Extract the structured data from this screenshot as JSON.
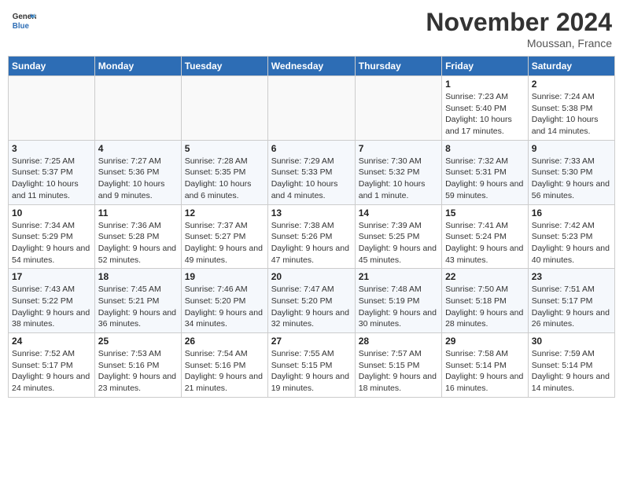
{
  "header": {
    "logo_general": "General",
    "logo_blue": "Blue",
    "month_title": "November 2024",
    "location": "Moussan, France"
  },
  "weekdays": [
    "Sunday",
    "Monday",
    "Tuesday",
    "Wednesday",
    "Thursday",
    "Friday",
    "Saturday"
  ],
  "weeks": [
    [
      {
        "day": "",
        "sunrise": "",
        "sunset": "",
        "daylight": ""
      },
      {
        "day": "",
        "sunrise": "",
        "sunset": "",
        "daylight": ""
      },
      {
        "day": "",
        "sunrise": "",
        "sunset": "",
        "daylight": ""
      },
      {
        "day": "",
        "sunrise": "",
        "sunset": "",
        "daylight": ""
      },
      {
        "day": "",
        "sunrise": "",
        "sunset": "",
        "daylight": ""
      },
      {
        "day": "1",
        "sunrise": "Sunrise: 7:23 AM",
        "sunset": "Sunset: 5:40 PM",
        "daylight": "Daylight: 10 hours and 17 minutes."
      },
      {
        "day": "2",
        "sunrise": "Sunrise: 7:24 AM",
        "sunset": "Sunset: 5:38 PM",
        "daylight": "Daylight: 10 hours and 14 minutes."
      }
    ],
    [
      {
        "day": "3",
        "sunrise": "Sunrise: 7:25 AM",
        "sunset": "Sunset: 5:37 PM",
        "daylight": "Daylight: 10 hours and 11 minutes."
      },
      {
        "day": "4",
        "sunrise": "Sunrise: 7:27 AM",
        "sunset": "Sunset: 5:36 PM",
        "daylight": "Daylight: 10 hours and 9 minutes."
      },
      {
        "day": "5",
        "sunrise": "Sunrise: 7:28 AM",
        "sunset": "Sunset: 5:35 PM",
        "daylight": "Daylight: 10 hours and 6 minutes."
      },
      {
        "day": "6",
        "sunrise": "Sunrise: 7:29 AM",
        "sunset": "Sunset: 5:33 PM",
        "daylight": "Daylight: 10 hours and 4 minutes."
      },
      {
        "day": "7",
        "sunrise": "Sunrise: 7:30 AM",
        "sunset": "Sunset: 5:32 PM",
        "daylight": "Daylight: 10 hours and 1 minute."
      },
      {
        "day": "8",
        "sunrise": "Sunrise: 7:32 AM",
        "sunset": "Sunset: 5:31 PM",
        "daylight": "Daylight: 9 hours and 59 minutes."
      },
      {
        "day": "9",
        "sunrise": "Sunrise: 7:33 AM",
        "sunset": "Sunset: 5:30 PM",
        "daylight": "Daylight: 9 hours and 56 minutes."
      }
    ],
    [
      {
        "day": "10",
        "sunrise": "Sunrise: 7:34 AM",
        "sunset": "Sunset: 5:29 PM",
        "daylight": "Daylight: 9 hours and 54 minutes."
      },
      {
        "day": "11",
        "sunrise": "Sunrise: 7:36 AM",
        "sunset": "Sunset: 5:28 PM",
        "daylight": "Daylight: 9 hours and 52 minutes."
      },
      {
        "day": "12",
        "sunrise": "Sunrise: 7:37 AM",
        "sunset": "Sunset: 5:27 PM",
        "daylight": "Daylight: 9 hours and 49 minutes."
      },
      {
        "day": "13",
        "sunrise": "Sunrise: 7:38 AM",
        "sunset": "Sunset: 5:26 PM",
        "daylight": "Daylight: 9 hours and 47 minutes."
      },
      {
        "day": "14",
        "sunrise": "Sunrise: 7:39 AM",
        "sunset": "Sunset: 5:25 PM",
        "daylight": "Daylight: 9 hours and 45 minutes."
      },
      {
        "day": "15",
        "sunrise": "Sunrise: 7:41 AM",
        "sunset": "Sunset: 5:24 PM",
        "daylight": "Daylight: 9 hours and 43 minutes."
      },
      {
        "day": "16",
        "sunrise": "Sunrise: 7:42 AM",
        "sunset": "Sunset: 5:23 PM",
        "daylight": "Daylight: 9 hours and 40 minutes."
      }
    ],
    [
      {
        "day": "17",
        "sunrise": "Sunrise: 7:43 AM",
        "sunset": "Sunset: 5:22 PM",
        "daylight": "Daylight: 9 hours and 38 minutes."
      },
      {
        "day": "18",
        "sunrise": "Sunrise: 7:45 AM",
        "sunset": "Sunset: 5:21 PM",
        "daylight": "Daylight: 9 hours and 36 minutes."
      },
      {
        "day": "19",
        "sunrise": "Sunrise: 7:46 AM",
        "sunset": "Sunset: 5:20 PM",
        "daylight": "Daylight: 9 hours and 34 minutes."
      },
      {
        "day": "20",
        "sunrise": "Sunrise: 7:47 AM",
        "sunset": "Sunset: 5:20 PM",
        "daylight": "Daylight: 9 hours and 32 minutes."
      },
      {
        "day": "21",
        "sunrise": "Sunrise: 7:48 AM",
        "sunset": "Sunset: 5:19 PM",
        "daylight": "Daylight: 9 hours and 30 minutes."
      },
      {
        "day": "22",
        "sunrise": "Sunrise: 7:50 AM",
        "sunset": "Sunset: 5:18 PM",
        "daylight": "Daylight: 9 hours and 28 minutes."
      },
      {
        "day": "23",
        "sunrise": "Sunrise: 7:51 AM",
        "sunset": "Sunset: 5:17 PM",
        "daylight": "Daylight: 9 hours and 26 minutes."
      }
    ],
    [
      {
        "day": "24",
        "sunrise": "Sunrise: 7:52 AM",
        "sunset": "Sunset: 5:17 PM",
        "daylight": "Daylight: 9 hours and 24 minutes."
      },
      {
        "day": "25",
        "sunrise": "Sunrise: 7:53 AM",
        "sunset": "Sunset: 5:16 PM",
        "daylight": "Daylight: 9 hours and 23 minutes."
      },
      {
        "day": "26",
        "sunrise": "Sunrise: 7:54 AM",
        "sunset": "Sunset: 5:16 PM",
        "daylight": "Daylight: 9 hours and 21 minutes."
      },
      {
        "day": "27",
        "sunrise": "Sunrise: 7:55 AM",
        "sunset": "Sunset: 5:15 PM",
        "daylight": "Daylight: 9 hours and 19 minutes."
      },
      {
        "day": "28",
        "sunrise": "Sunrise: 7:57 AM",
        "sunset": "Sunset: 5:15 PM",
        "daylight": "Daylight: 9 hours and 18 minutes."
      },
      {
        "day": "29",
        "sunrise": "Sunrise: 7:58 AM",
        "sunset": "Sunset: 5:14 PM",
        "daylight": "Daylight: 9 hours and 16 minutes."
      },
      {
        "day": "30",
        "sunrise": "Sunrise: 7:59 AM",
        "sunset": "Sunset: 5:14 PM",
        "daylight": "Daylight: 9 hours and 14 minutes."
      }
    ]
  ]
}
